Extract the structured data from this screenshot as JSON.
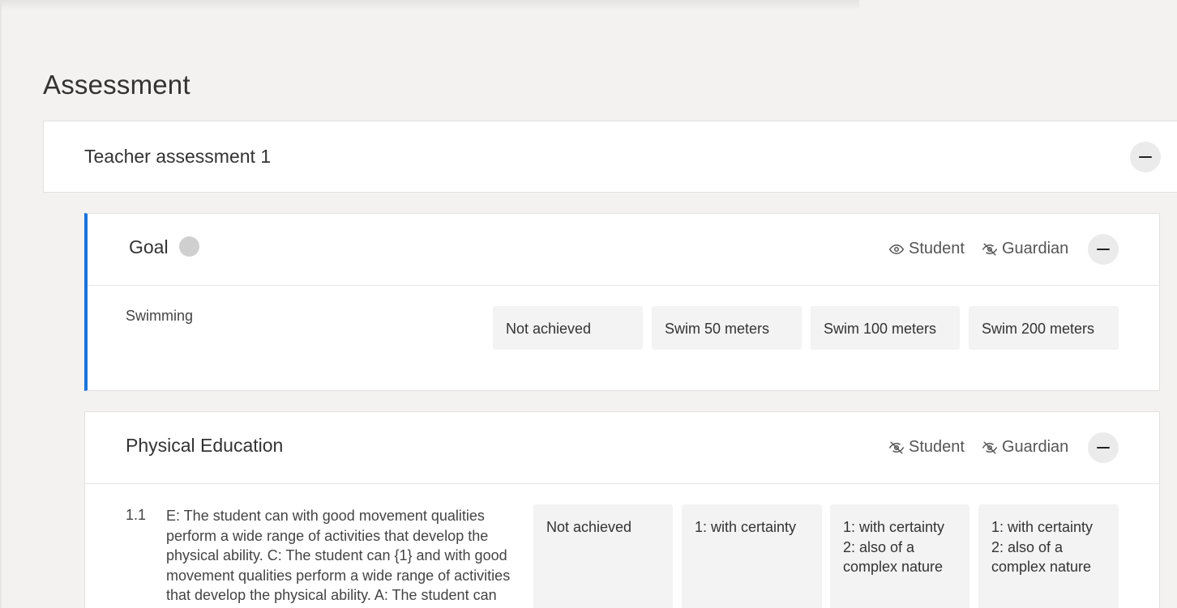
{
  "page": {
    "title": "Assessment"
  },
  "teacher_assessment": {
    "title": "Teacher assessment 1"
  },
  "goal_panel": {
    "title": "Goal",
    "visibility": {
      "student": "Student",
      "guardian": "Guardian"
    },
    "row": {
      "label": "Swimming",
      "options": [
        "Not achieved",
        "Swim 50 meters",
        "Swim 100 meters",
        "Swim 200 meters"
      ]
    }
  },
  "pe_panel": {
    "title": "Physical Education",
    "visibility": {
      "student": "Student",
      "guardian": "Guardian"
    },
    "criterion": {
      "number": "1.1",
      "text": "E: The student can with good movement qualities perform a wide range of activities that develop the physical ability. C: The student can {1} and with good movement qualities perform a wide range of activities that develop the physical ability. A: The student can with certainty and with good movement qualities",
      "options": [
        "Not achieved",
        "1: with certainty",
        "1: with certainty 2: also of a complex nature",
        "1: with certainty 2: also of a complex nature"
      ]
    }
  },
  "icons": {
    "collapse": "minus-icon",
    "visible": "eye-icon",
    "hidden": "eye-off-icon",
    "status": "status-dot"
  },
  "colors": {
    "accent": "#1a73d9",
    "background": "#f3f2f1",
    "option_bg": "#f3f3f3",
    "status_dot": "#cfcfcf"
  }
}
